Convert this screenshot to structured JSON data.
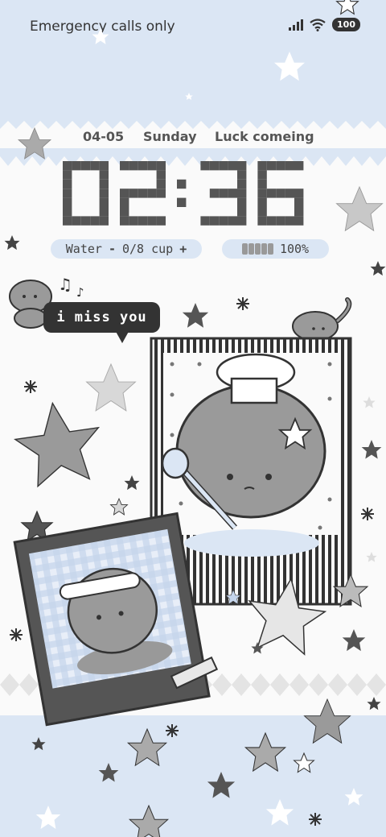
{
  "status_bar": {
    "carrier_text": "Emergency calls only",
    "battery": "100",
    "icons": [
      "signal-icon",
      "wifi-icon",
      "battery-icon"
    ]
  },
  "widget": {
    "date": "04-05",
    "weekday": "Sunday",
    "motto": "Luck comeing",
    "time": "02:36"
  },
  "water": {
    "label": "Water",
    "minus": "-",
    "progress": "0/8 cup",
    "plus": "+"
  },
  "battery_widget": {
    "level_text": "100%",
    "level_fraction": 1.0
  },
  "sticker": {
    "bubble_text": "i miss you",
    "music_note": "♫ ♪"
  },
  "colors": {
    "sky": "#dbe6f4",
    "paper": "#fafafa",
    "ink": "#333333",
    "star_gray": "#9a9a9a",
    "star_dark": "#555555"
  }
}
